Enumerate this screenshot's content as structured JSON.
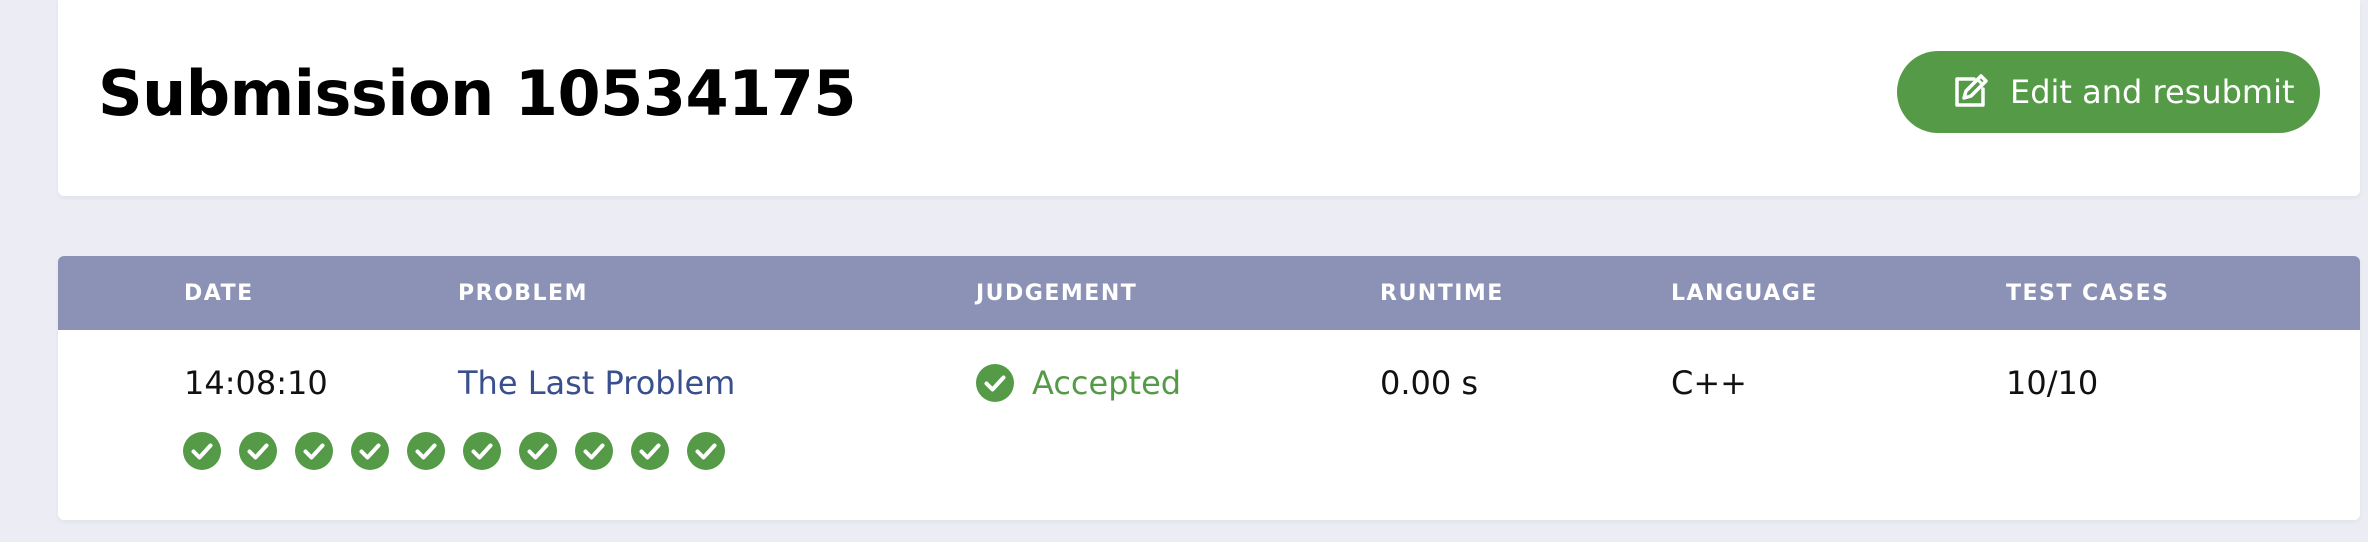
{
  "header": {
    "title": "Submission 10534175",
    "resubmit_label": "Edit and resubmit",
    "resubmit_icon": "edit-icon"
  },
  "table": {
    "columns": [
      "DATE",
      "PROBLEM",
      "JUDGEMENT",
      "RUNTIME",
      "LANGUAGE",
      "TEST CASES"
    ],
    "row": {
      "date": "14:08:10",
      "problem": "The Last Problem",
      "judgement": "Accepted",
      "runtime": "0.00 s",
      "language": "C++",
      "test_cases": "10/10"
    },
    "test_case_results": [
      "passed",
      "passed",
      "passed",
      "passed",
      "passed",
      "passed",
      "passed",
      "passed",
      "passed",
      "passed"
    ]
  },
  "colors": {
    "accent_green": "#559b47",
    "header_bar": "#8c92b6",
    "link": "#3a4f8d",
    "page_background": "#ecedf4"
  }
}
